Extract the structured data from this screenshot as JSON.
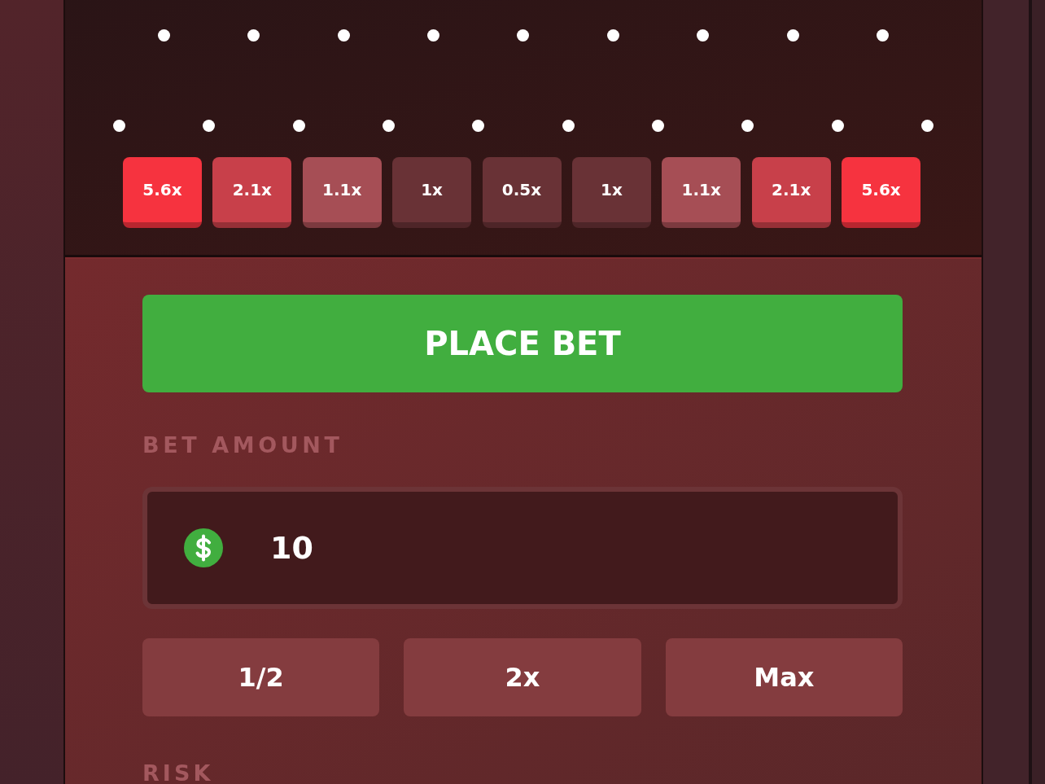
{
  "plinko_board": {
    "multipliers": [
      {
        "label": "5.6x",
        "color": "#f6333f"
      },
      {
        "label": "2.1x",
        "color": "#c8404a"
      },
      {
        "label": "1.1x",
        "color": "#a64e55"
      },
      {
        "label": "1x",
        "color": "#693236"
      },
      {
        "label": "0.5x",
        "color": "#693236"
      },
      {
        "label": "1x",
        "color": "#693236"
      },
      {
        "label": "1.1x",
        "color": "#a64e55"
      },
      {
        "label": "2.1x",
        "color": "#c8404a"
      },
      {
        "label": "5.6x",
        "color": "#f6333f"
      }
    ]
  },
  "place_bet_button": {
    "label": "PLACE BET"
  },
  "bet_amount": {
    "label": "BET AMOUNT",
    "value": "10"
  },
  "amount_buttons": [
    {
      "label": "1/2"
    },
    {
      "label": "2x"
    },
    {
      "label": "Max"
    }
  ],
  "risk": {
    "label": "RISK"
  }
}
